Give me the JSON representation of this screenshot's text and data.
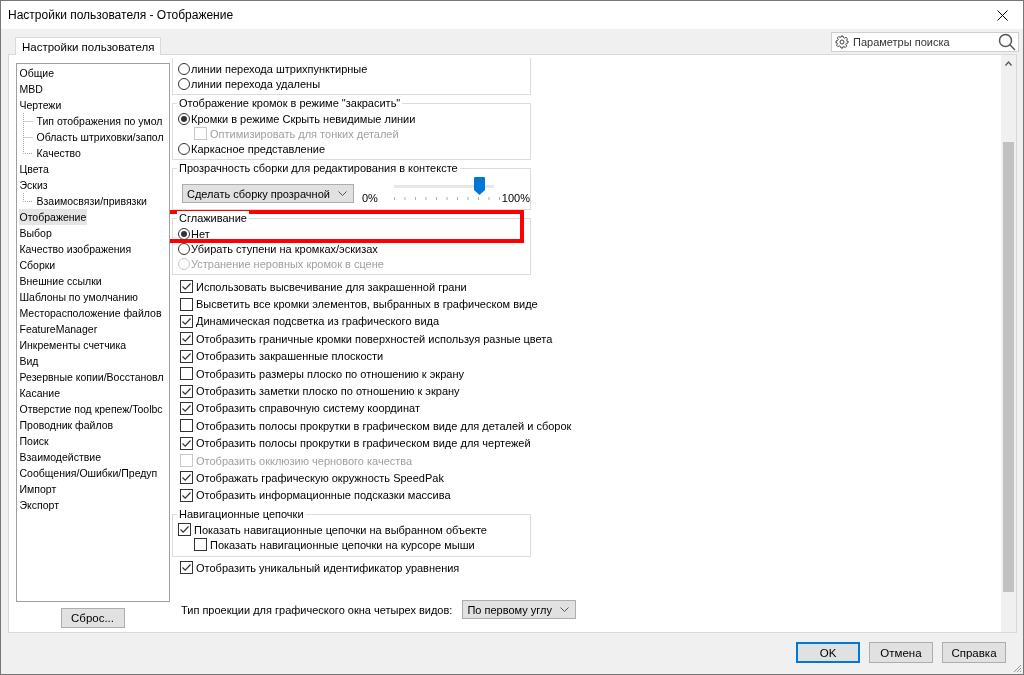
{
  "window": {
    "title": "Настройки пользователя - Отображение"
  },
  "tabs": [
    {
      "label": "Настройки пользователя",
      "selected": true
    }
  ],
  "search": {
    "placeholder": "Параметры поиска"
  },
  "tree": [
    {
      "label": "Общие",
      "selected": false
    },
    {
      "label": "MBD",
      "selected": false
    },
    {
      "label": "Чертежи",
      "selected": false,
      "children": [
        {
          "label": "Тип отображения по умол",
          "selected": false
        },
        {
          "label": "Область штриховки/запол",
          "selected": false
        },
        {
          "label": "Качество",
          "selected": false
        }
      ]
    },
    {
      "label": "Цвета",
      "selected": false
    },
    {
      "label": "Эскиз",
      "selected": false,
      "children": [
        {
          "label": "Взаимосвязи/привязки",
          "selected": false
        }
      ]
    },
    {
      "label": "Отображение",
      "selected": true
    },
    {
      "label": "Выбор",
      "selected": false
    },
    {
      "label": "Качество изображения",
      "selected": false
    },
    {
      "label": "Сборки",
      "selected": false
    },
    {
      "label": "Внешние ссылки",
      "selected": false
    },
    {
      "label": "Шаблоны по умолчанию",
      "selected": false
    },
    {
      "label": "Месторасположение файлов",
      "selected": false
    },
    {
      "label": "FeatureManager",
      "selected": false
    },
    {
      "label": "Инкременты счетчика",
      "selected": false
    },
    {
      "label": "Вид",
      "selected": false
    },
    {
      "label": "Резервные копии/Восстановл",
      "selected": false
    },
    {
      "label": "Касание",
      "selected": false
    },
    {
      "label": "Отверстие под крепеж/Toolbc",
      "selected": false
    },
    {
      "label": "Проводник файлов",
      "selected": false
    },
    {
      "label": "Поиск",
      "selected": false
    },
    {
      "label": "Взаимодействие",
      "selected": false
    },
    {
      "label": "Сообщения/Ошибки/Предуп",
      "selected": false
    },
    {
      "label": "Импорт",
      "selected": false
    },
    {
      "label": "Экспорт",
      "selected": false
    }
  ],
  "reset_button": "Сброс...",
  "sections": [
    {
      "kind": "group",
      "highlighted": false,
      "items": [
        {
          "kind": "radio",
          "label": "линии перехода штрихпунктирные",
          "selected": false,
          "disabled": false
        },
        {
          "kind": "radio",
          "label": "линии перехода удалены",
          "selected": false,
          "disabled": false
        }
      ]
    },
    {
      "kind": "group",
      "title": "Отображение кромок в режиме \"закрасить\"",
      "highlighted": false,
      "items": [
        {
          "kind": "radio",
          "label": "Кромки в режиме Скрыть невидимые линии",
          "selected": true,
          "disabled": false,
          "children": [
            {
              "kind": "checkbox",
              "label": "Оптимизировать для тонких деталей",
              "checked": false,
              "disabled": true
            }
          ]
        },
        {
          "kind": "radio",
          "label": "Каркасное представление",
          "selected": false,
          "disabled": false
        }
      ]
    },
    {
      "kind": "group",
      "title": "Прозрачность сборки для редактирования в контексте",
      "highlighted": false,
      "items": [
        {
          "kind": "transparency",
          "dropdown": "Сделать сборку прозрачной",
          "min_label": "0%",
          "max_label": "100%",
          "level": 0.85
        }
      ]
    },
    {
      "kind": "group",
      "title": "Сглаживание",
      "highlighted": true,
      "items": [
        {
          "kind": "radio",
          "label": "Нет",
          "selected": true,
          "disabled": false
        },
        {
          "kind": "radio",
          "label": "Убирать ступени на кромках/эскизах",
          "selected": false,
          "disabled": false
        },
        {
          "kind": "radio",
          "label": "Устранение неровных кромок в сцене",
          "selected": false,
          "disabled": true
        }
      ]
    },
    {
      "kind": "checkbox",
      "label": "Использовать высвечивание для закрашенной грани",
      "checked": true,
      "disabled": false
    },
    {
      "kind": "checkbox",
      "label": "Высветить все кромки элементов, выбранных в графическом виде",
      "checked": false,
      "disabled": false
    },
    {
      "kind": "checkbox",
      "label": "Динамическая подсветка из графического вида",
      "checked": true,
      "disabled": false
    },
    {
      "kind": "checkbox",
      "label": "Отобразить граничные кромки поверхностей используя разные цвета",
      "checked": true,
      "disabled": false
    },
    {
      "kind": "checkbox",
      "label": "Отобразить закрашенные плоскости",
      "checked": true,
      "disabled": false
    },
    {
      "kind": "checkbox",
      "label": "Отобразить размеры плоско по отношению к экрану",
      "checked": false,
      "disabled": false
    },
    {
      "kind": "checkbox",
      "label": "Отобразить заметки плоско по отношению к экрану",
      "checked": true,
      "disabled": false
    },
    {
      "kind": "checkbox",
      "label": "Отобразить справочную систему координат",
      "checked": true,
      "disabled": false
    },
    {
      "kind": "checkbox",
      "label": "Отобразить полосы прокрутки в графическом виде для деталей и сборок",
      "checked": false,
      "disabled": false
    },
    {
      "kind": "checkbox",
      "label": "Отобразить полосы прокрутки в графическом виде для чертежей",
      "checked": true,
      "disabled": false
    },
    {
      "kind": "checkbox",
      "label": "Отобразить окклюзию чернового качества",
      "checked": false,
      "disabled": true
    },
    {
      "kind": "checkbox",
      "label": "Отображать графическую окружность SpeedPak",
      "checked": true,
      "disabled": false
    },
    {
      "kind": "checkbox",
      "label": "Отобразить информационные подсказки массива",
      "checked": true,
      "disabled": false
    },
    {
      "kind": "group",
      "title": "Навигационные цепочки",
      "highlighted": false,
      "items": [
        {
          "kind": "checkbox",
          "label": "Показать навигационные цепочки на выбранном объекте",
          "checked": true,
          "disabled": false,
          "children": [
            {
              "kind": "checkbox",
              "label": "Показать навигационные цепочки на курсоре мыши",
              "checked": false,
              "disabled": false
            }
          ]
        }
      ]
    },
    {
      "kind": "checkbox",
      "label": "Отобразить уникальный идентификатор уравнения",
      "checked": true,
      "disabled": false
    },
    {
      "kind": "select_row",
      "label": "Тип проекции для графического окна четырех видов:",
      "value": "По первому углу"
    }
  ],
  "buttons": [
    {
      "label": "OK",
      "default": true
    },
    {
      "label": "Отмена",
      "default": false
    },
    {
      "label": "Справка",
      "default": false
    }
  ]
}
